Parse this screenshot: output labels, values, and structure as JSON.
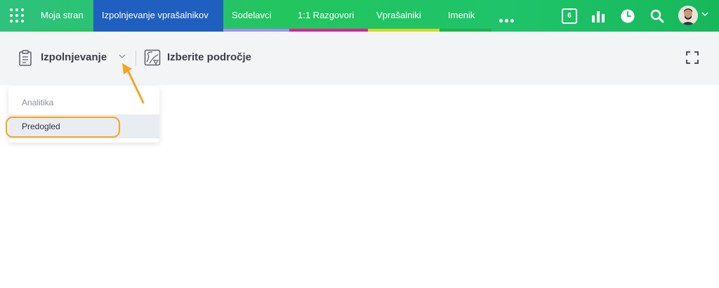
{
  "nav": {
    "items": [
      {
        "label": "Moja stran",
        "bar": "#29c25f"
      },
      {
        "label": "Izpolnjevanje vprašalnikov",
        "bar": "#1f5fbf"
      },
      {
        "label": "Sodelavci",
        "bar": "#a78bfa"
      },
      {
        "label": "1:1 Razgovori",
        "bar": "#e11d98"
      },
      {
        "label": "Vprašalniki",
        "bar": "#d8d61f"
      },
      {
        "label": "Imenik",
        "bar": "#1fb24a"
      }
    ],
    "calendar_day": "6"
  },
  "toolbar": {
    "section_label": "Izpolnjevanje",
    "area_label": "Izberite področje"
  },
  "dropdown": {
    "items": [
      {
        "label": "Analitika"
      },
      {
        "label": "Predogled"
      }
    ]
  },
  "colors": {
    "nav_active": "#1f5fbf",
    "highlight": "#f5a623",
    "toolbar_bg": "#f3f4f6"
  },
  "icons": {
    "apps": "grid-icon",
    "more": "more-dots-icon",
    "calendar": "calendar-icon",
    "stats": "bar-chart-icon",
    "time": "clock-icon",
    "search": "search-icon",
    "section": "clipboard-icon",
    "area": "map-icon",
    "fullscreen": "fullscreen-icon"
  }
}
